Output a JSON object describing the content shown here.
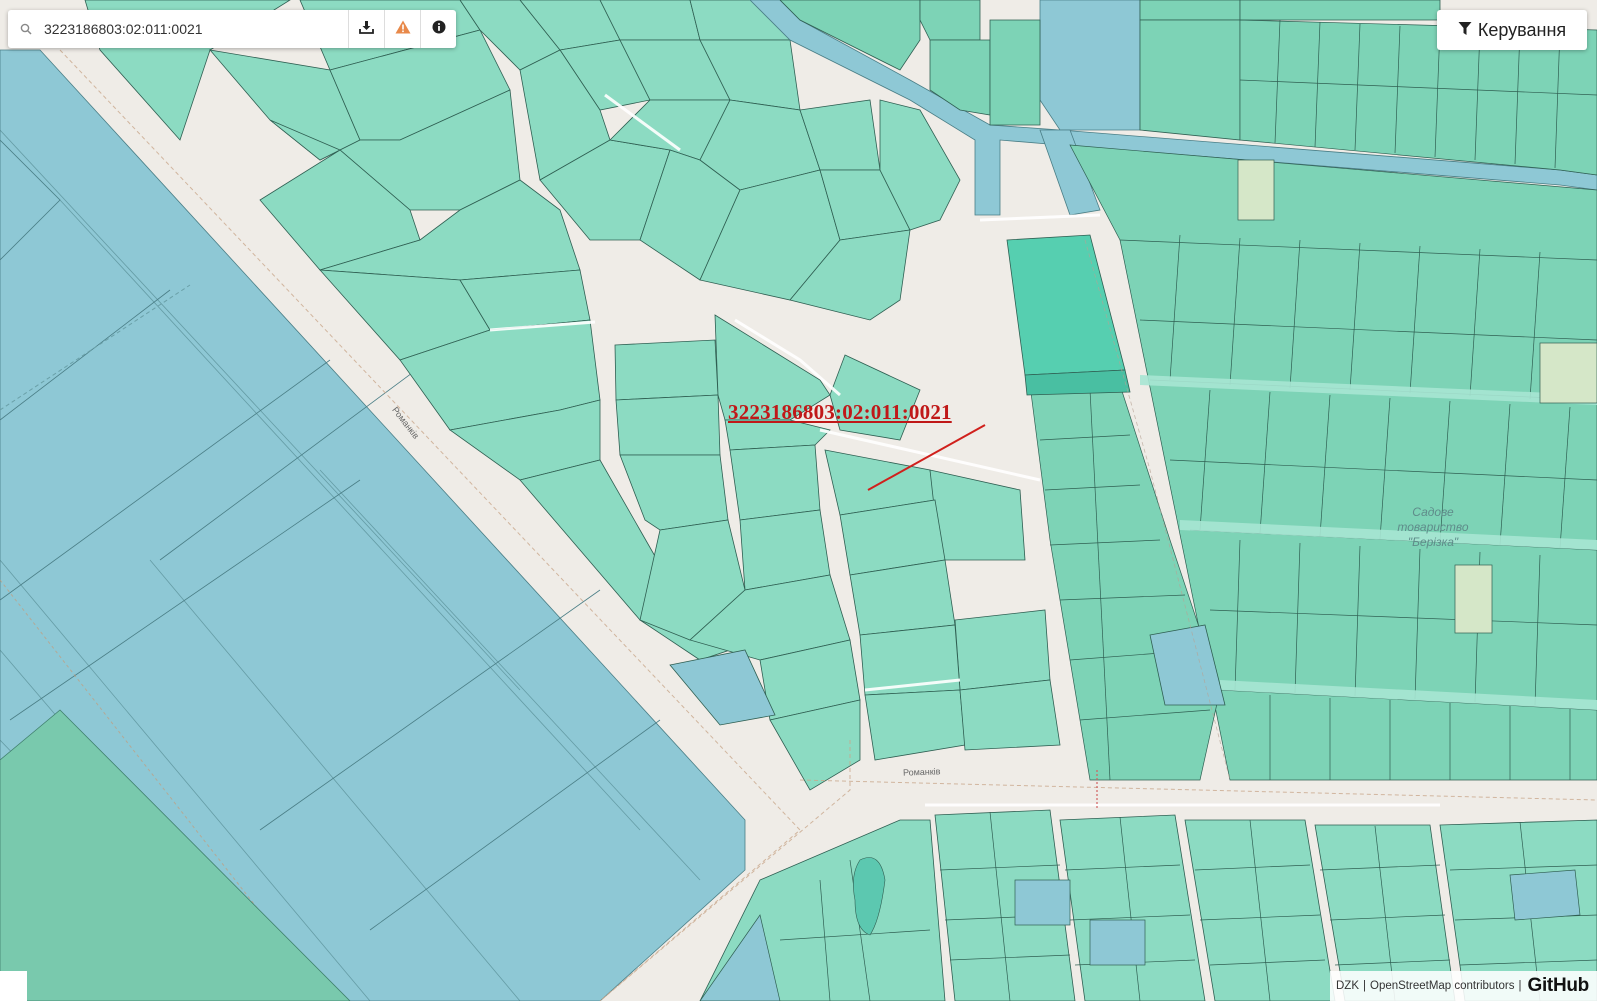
{
  "search": {
    "value": "3223186803:02:011:0021",
    "placeholder": ""
  },
  "toolbar": {
    "icons": [
      "download-icon",
      "warning-icon",
      "info-icon"
    ]
  },
  "control": {
    "label": "Керування",
    "icon": "filter-icon"
  },
  "parcel": {
    "cadastral_number": "3223186803:02:011:0021"
  },
  "streets": {
    "diagonal": "Романків",
    "lower": "Романків"
  },
  "garden_society": {
    "line1": "Садове",
    "line2": "товариство",
    "line3": "\"Берізка\""
  },
  "attribution": {
    "dzk": "DZK",
    "separator": "|",
    "osm": "OpenStreetMap contributors",
    "separator2": "|",
    "github": "GitHub"
  },
  "colors": {
    "background": "#efece7",
    "parcel_green": "#8cdbc2",
    "parcel_teal": "#79d2b3",
    "water_blue": "#8ec8d5",
    "highlight_parcel": "#56cfb0",
    "label_red": "#c01818",
    "pointer_red": "#d0201c"
  }
}
